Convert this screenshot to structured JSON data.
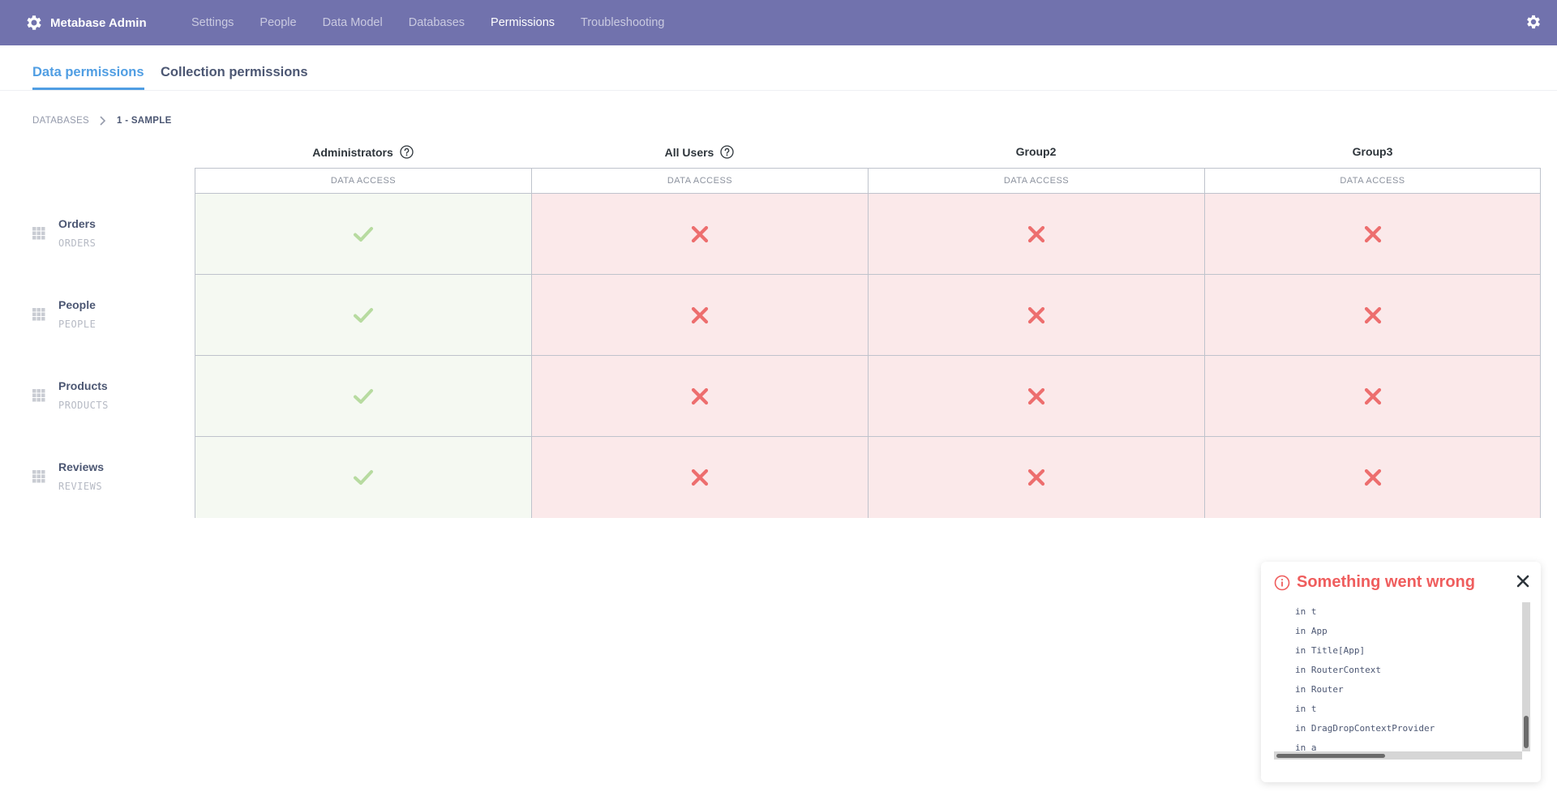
{
  "nav": {
    "brand": "Metabase Admin",
    "items": [
      "Settings",
      "People",
      "Data Model",
      "Databases",
      "Permissions",
      "Troubleshooting"
    ],
    "active": "Permissions",
    "bg_color": "#7172ad"
  },
  "tabs": {
    "data_permissions": "Data permissions",
    "collection_permissions": "Collection permissions",
    "active": "Data permissions",
    "accent_color": "#509ee3"
  },
  "breadcrumb": {
    "root": "DATABASES",
    "current": "1 - SAMPLE"
  },
  "groups": [
    {
      "name": "Administrators",
      "help": true
    },
    {
      "name": "All Users",
      "help": true
    },
    {
      "name": "Group2",
      "help": false
    },
    {
      "name": "Group3",
      "help": false
    }
  ],
  "column_subheader": "DATA ACCESS",
  "tables": [
    {
      "name": "Orders",
      "schema": "ORDERS",
      "access": [
        "granted",
        "denied",
        "denied",
        "denied"
      ]
    },
    {
      "name": "People",
      "schema": "PEOPLE",
      "access": [
        "granted",
        "denied",
        "denied",
        "denied"
      ]
    },
    {
      "name": "Products",
      "schema": "PRODUCTS",
      "access": [
        "granted",
        "denied",
        "denied",
        "denied"
      ]
    },
    {
      "name": "Reviews",
      "schema": "REVIEWS",
      "access": [
        "granted",
        "denied",
        "denied",
        "denied"
      ]
    }
  ],
  "colors": {
    "granted_bg": "#f5f9f2",
    "granted_icon": "#b7dba0",
    "denied_bg": "#fbe9ea",
    "denied_icon": "#ed6e6e"
  },
  "error": {
    "title": "Something went wrong",
    "trace": [
      "in t",
      "in App",
      "in Title[App]",
      "in RouterContext",
      "in Router",
      "in t",
      "in DragDropContextProvider",
      "in a"
    ],
    "color": "#ef5d5d"
  }
}
